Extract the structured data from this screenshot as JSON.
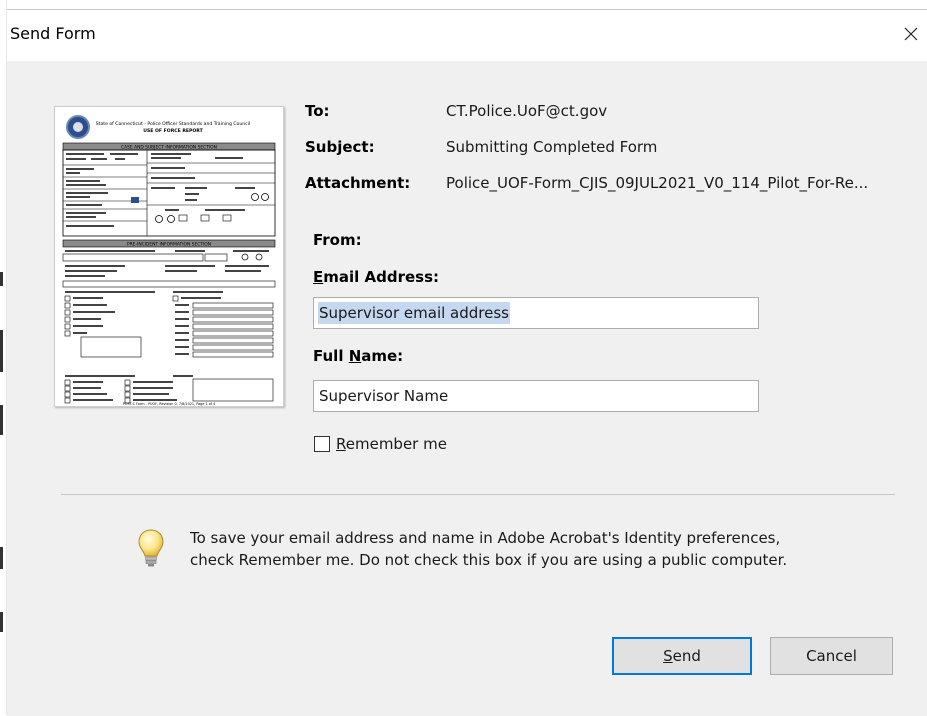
{
  "window": {
    "title": "Send Form",
    "close_glyph": "✕"
  },
  "form_preview": {
    "header_line1": "State of Connecticut - Police Officer Standards and Training Council",
    "header_line2": "USE OF FORCE REPORT",
    "section1": "CASE AND SUBJECT INFORMATION SECTION",
    "section2": "PRE-INCIDENT INFORMATION SECTION",
    "footer": "POST-C Form - PUOF, Revision 0, 7/8/2021, Page 1 of 4"
  },
  "fields": {
    "to_label": "To:",
    "to_value": "CT.Police.UoF@ct.gov",
    "subject_label": "Subject:",
    "subject_value": "Submitting Completed Form",
    "attachment_label": "Attachment:",
    "attachment_value": "Police_UOF-Form_CJIS_09JUL2021_V0_114_Pilot_For-Re...",
    "from_label": "From:",
    "email_label_underlined": "E",
    "email_label_rest": "mail Address:",
    "email_value": "Supervisor email address",
    "name_label_pre": "Full ",
    "name_label_underlined": "N",
    "name_label_rest": "ame:",
    "name_value": "Supervisor Name"
  },
  "remember": {
    "label_underlined": "R",
    "label_rest": "emember me",
    "checked": false
  },
  "info": {
    "text": "To save your email address and name in Adobe Acrobat's Identity preferences, check Remember me. Do not check this box if you are using a public computer."
  },
  "buttons": {
    "send_underlined": "S",
    "send_rest": "end",
    "cancel": "Cancel"
  },
  "colors": {
    "dialog_bg": "#f0f0f0",
    "selection": "#c5d8f0",
    "focus_border": "#0078d7",
    "button_bg": "#e1e1e1"
  }
}
